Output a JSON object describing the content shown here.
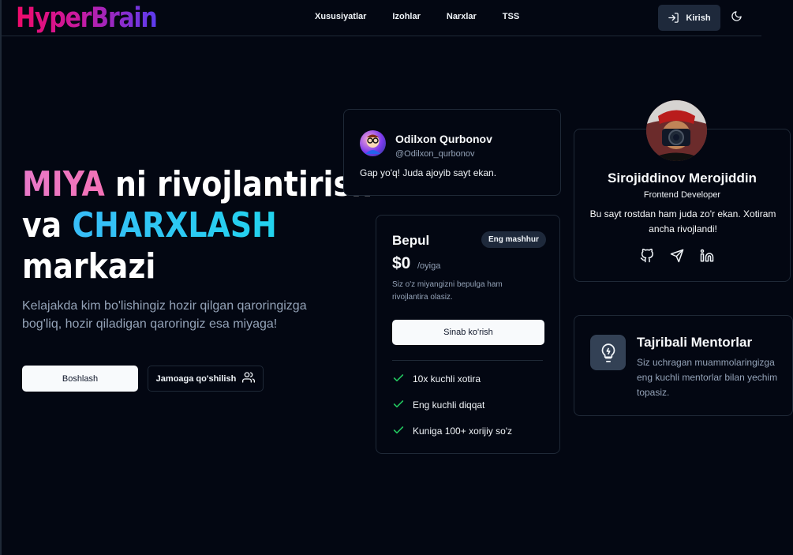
{
  "brand": {
    "logo": "HyperBrain"
  },
  "nav": {
    "links": [
      "Xususiyatlar",
      "Izohlar",
      "Narxlar",
      "TSS"
    ],
    "login_label": "Kirish"
  },
  "hero": {
    "title_highlight1": "MIYA",
    "title_part1": " ni rivojlantirish",
    "title_part2": "va ",
    "title_highlight2": "CHARXLASH",
    "title_part3": "markazi",
    "subtitle": "Kelajakda kim bo'lishingiz hozir qilgan qaroringizga bog'liq, hozir qiladigan qaroringiz esa miyaga!",
    "start_label": "Boshlash",
    "team_label": "Jamoaga qo'shilish"
  },
  "review": {
    "name": "Odilxon Qurbonov",
    "handle": "@Odilxon_qurbonov",
    "text": "Gap yo'q! Juda ajoyib sayt ekan."
  },
  "pricing": {
    "title": "Bepul",
    "badge": "Eng mashhur",
    "price": "$0",
    "period": "/oyiga",
    "description": "Siz o'z miyangizni bepulga ham rivojlantira olasiz.",
    "cta": "Sinab ko'rish",
    "features": [
      "10x kuchli xotira",
      "Eng kuchli diqqat",
      "Kuniga 100+ xorijiy so'z"
    ]
  },
  "profile": {
    "name": "Sirojiddinov Merojiddin",
    "role": "Frontend Developer",
    "quote": "Bu sayt rostdan ham juda zo'r ekan. Xotiram ancha rivojlandi!"
  },
  "mentor": {
    "title": "Tajribali Mentorlar",
    "description": "Siz uchragan muammolaringizga eng kuchli mentorlar bilan yechim topasiz."
  },
  "colors": {
    "background": "#030712",
    "accent_pink": "#f472b6",
    "accent_cyan": "#38bdf8",
    "check_green": "#22c55e"
  }
}
